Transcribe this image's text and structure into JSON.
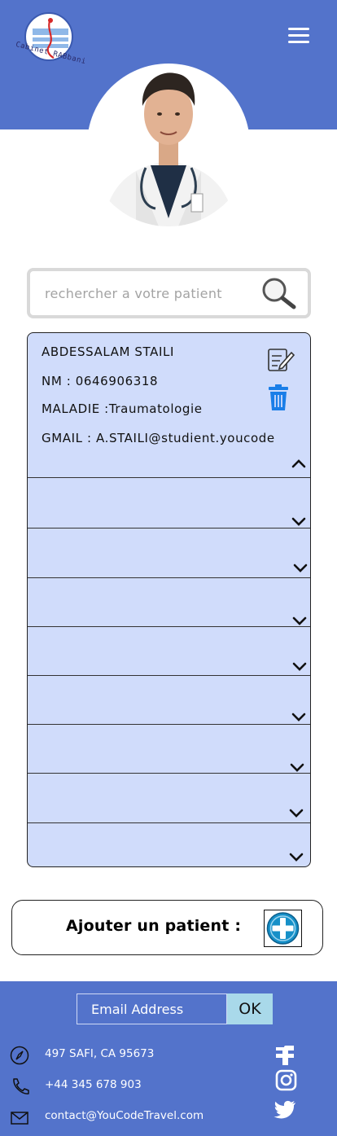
{
  "header": {
    "logo_text": "Cabinet RABbani",
    "menu_icon": "hamburger-menu-icon"
  },
  "profile": {
    "avatar_icon": "doctor-photo"
  },
  "search": {
    "placeholder": "rechercher a votre patient",
    "icon": "search-icon"
  },
  "patients": {
    "expanded": {
      "name": "ABDESSALAM STAILI",
      "nm": "NM : 0646906318",
      "maladie": "MALADIE :Traumatologie",
      "gmail": "GMAIL : A.STAILI@studient.youcode",
      "edit_icon": "edit-icon",
      "delete_icon": "trash-icon",
      "collapse_icon": "chevron-up-icon"
    },
    "collapsed_count_icon": "chevron-down-icon",
    "collapsed_rows": [
      {
        "label": ""
      },
      {
        "label": ""
      },
      {
        "label": ""
      },
      {
        "label": ""
      },
      {
        "label": ""
      },
      {
        "label": ""
      },
      {
        "label": ""
      },
      {
        "label": ""
      }
    ]
  },
  "add_patient": {
    "label": "Ajouter un patient :",
    "icon": "plus-circle-icon"
  },
  "footer": {
    "email_placeholder": "Email Address",
    "ok_label": "OK",
    "address": "497  SAFI, CA 95673",
    "phone": "+44 345 678 903",
    "email": "contact@YouCodeTravel.com",
    "social": [
      "facebook-icon",
      "instagram-icon",
      "twitter-icon"
    ]
  },
  "colors": {
    "brand_blue": "#5373cb",
    "list_bg": "#d0dcfb",
    "trash_blue": "#1a7ee8",
    "ok_bg": "#a9d9ea"
  }
}
